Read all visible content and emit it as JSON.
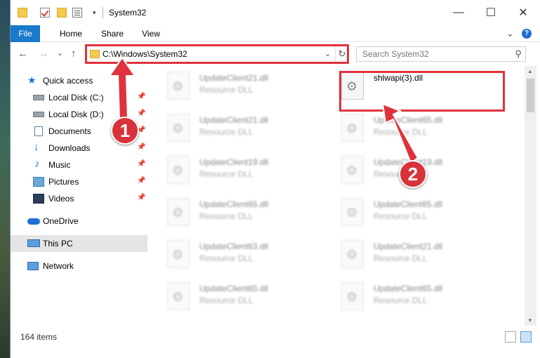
{
  "window": {
    "title": "System32",
    "qat_caret": "▾",
    "minimize_glyph": "—",
    "maximize_glyph": "☐",
    "close_glyph": "✕"
  },
  "ribbon": {
    "tabs": [
      "File",
      "Home",
      "Share",
      "View"
    ],
    "expand_glyph": "⌄",
    "help_glyph": "?"
  },
  "navigation": {
    "back_glyph": "←",
    "forward_glyph": "→",
    "recent_glyph": "⌄",
    "up_glyph": "↑",
    "address": "C:\\Windows\\System32",
    "address_caret": "⌄",
    "refresh_glyph": "↻",
    "search_placeholder": "Search System32",
    "search_glyph": "⚲"
  },
  "sidebar": {
    "pin_glyph": "📌",
    "items": [
      {
        "label": "Quick access",
        "icon": "star-icon"
      },
      {
        "label": "Local Disk (C:)",
        "icon": "drive-icon",
        "pinned": true
      },
      {
        "label": "Local Disk (D:)",
        "icon": "drive-icon",
        "pinned": true
      },
      {
        "label": "Documents",
        "icon": "documents-icon",
        "pinned": true
      },
      {
        "label": "Downloads",
        "icon": "download-icon",
        "pinned": true
      },
      {
        "label": "Music",
        "icon": "music-icon",
        "pinned": true
      },
      {
        "label": "Pictures",
        "icon": "pictures-icon",
        "pinned": true
      },
      {
        "label": "Videos",
        "icon": "videos-icon",
        "pinned": true
      },
      {
        "label": "OneDrive",
        "icon": "cloud-icon"
      },
      {
        "label": "This PC",
        "icon": "computer-icon",
        "selected": true
      },
      {
        "label": "Network",
        "icon": "network-icon"
      }
    ]
  },
  "files": [
    {
      "name": "UpdateClient21.dll",
      "type": "Resource DLL"
    },
    {
      "name": "shlwapi(3).dll",
      "type": ""
    },
    {
      "name": "UpdateClient21.dll",
      "type": "Resource DLL"
    },
    {
      "name": "UpdateClient65.dll",
      "type": "Resource DLL"
    },
    {
      "name": "UpdateClient19.dll",
      "type": "Resource DLL"
    },
    {
      "name": "UpdateClient19.dll",
      "type": "Resource DLL"
    },
    {
      "name": "UpdateClient65.dll",
      "type": "Resource DLL"
    },
    {
      "name": "UpdateClient65.dll",
      "type": "Resource DLL"
    },
    {
      "name": "UpdateClient63.dll",
      "type": "Resource DLL"
    },
    {
      "name": "UpdateClient21.dll",
      "type": "Resource DLL"
    },
    {
      "name": "UpdateClient65.dll",
      "type": "Resource DLL"
    },
    {
      "name": "UpdateClient65.dll",
      "type": "Resource DLL"
    }
  ],
  "scrollbar": {
    "up_glyph": "▲",
    "down_glyph": "▼"
  },
  "status": {
    "item_count": "164 items"
  },
  "annotations": {
    "step1": "1",
    "step2": "2",
    "color": "#e0323c"
  },
  "colors": {
    "file_tab": "#1979ca",
    "selected_nav": "#e5e5e5",
    "highlight_red": "#e0323c"
  }
}
